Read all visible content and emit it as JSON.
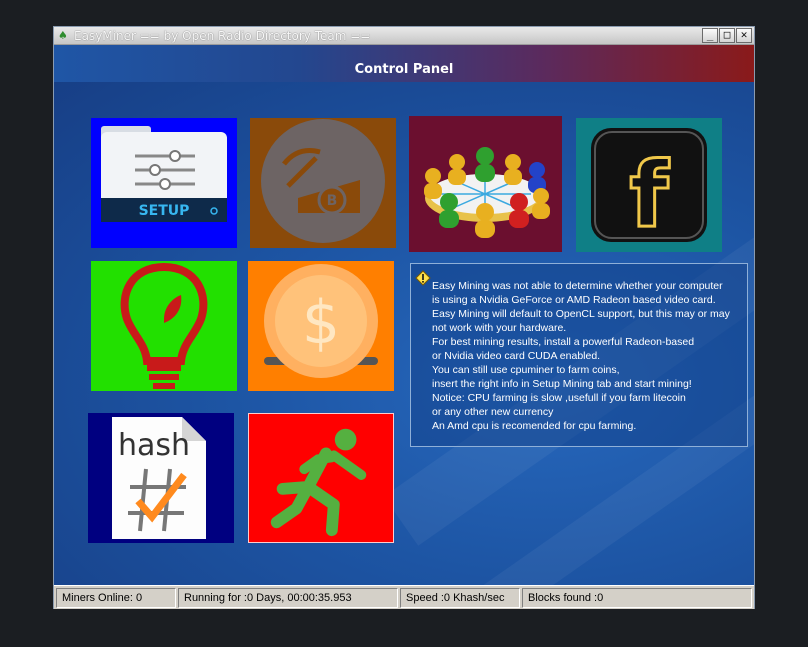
{
  "window": {
    "title": "EasyMiner == by Open Radio Directory Team ==",
    "minimize": "_",
    "maximize": "□",
    "close": "✕"
  },
  "header": {
    "title": "Control Panel"
  },
  "tiles": [
    {
      "id": "setup",
      "label": "SETUP",
      "icon": "folder-settings-icon",
      "color": "#0000ff"
    },
    {
      "id": "mining",
      "icon": "pickaxe-coin-icon",
      "color": "#8a4a0a"
    },
    {
      "id": "community",
      "icon": "people-network-icon",
      "color": "#6b0f2f"
    },
    {
      "id": "facebook",
      "label": "f",
      "icon": "facebook-icon",
      "color": "#0f7f86"
    },
    {
      "id": "tips",
      "icon": "lightbulb-icon",
      "color": "#22e000"
    },
    {
      "id": "donate",
      "label": "$",
      "icon": "dollar-coin-icon",
      "color": "#ff7f00"
    },
    {
      "id": "hash",
      "label": "hash",
      "icon": "hash-document-icon",
      "color": "#000080"
    },
    {
      "id": "run",
      "icon": "running-man-icon",
      "color": "#ff0000"
    }
  ],
  "info": {
    "icon": "warning-icon",
    "lines": [
      "Easy Mining was not able to determine whether your computer",
      "is using a Nvidia GeForce or AMD Radeon based video card.",
      "Easy Mining will default to OpenCL support, but this may or may",
      "not work with your hardware.",
      "For best mining results, install a powerful Radeon-based",
      "or Nvidia video card CUDA enabled.",
      "You can still use cpuminer to farm coins,",
      "insert the right info in Setup Mining tab and start mining!",
      "Notice: CPU farming is slow ,usefull if you farm litecoin",
      "or any other new currency",
      "An Amd cpu is recomended for cpu farming."
    ]
  },
  "status": {
    "miners": "Miners Online: 0",
    "running": "Running for :0 Days, 00:00:35.953",
    "speed": "Speed :0 Khash/sec",
    "blocks": "Blocks found :0"
  }
}
